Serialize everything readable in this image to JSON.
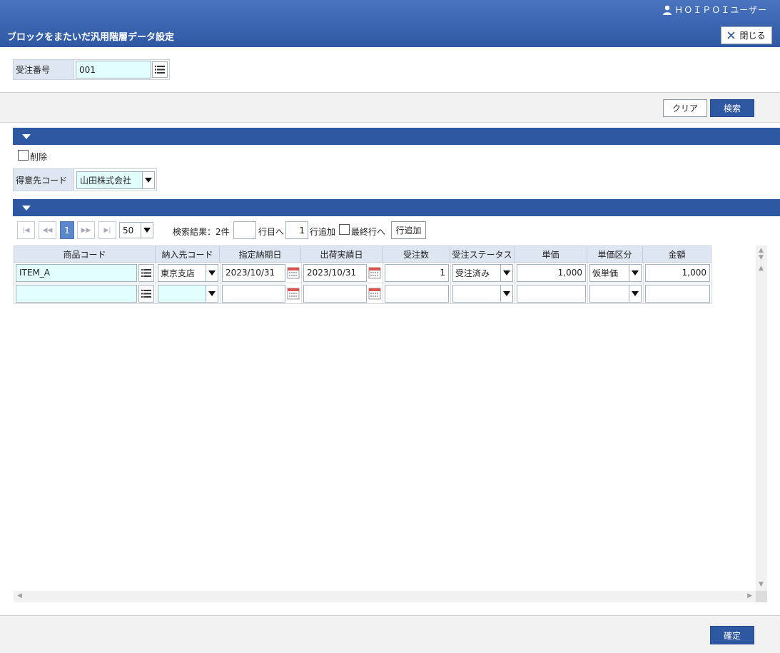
{
  "header": {
    "user_name": "ＨＯＩＰＯＩユーザー",
    "title": "ブロックをまたいだ汎用階層データ設定",
    "close_label": "閉じる"
  },
  "search": {
    "order_no_label": "受注番号",
    "order_no_value": "001",
    "clear_label": "クリア",
    "search_label": "検索"
  },
  "block1": {
    "delete_label": "削除",
    "customer_label": "得意先コード",
    "customer_value": "山田株式会社"
  },
  "pager": {
    "current_page": "1",
    "page_size": "50",
    "result_text": "検索結果：2件",
    "row_goto_value": "",
    "row_goto_label": "行目へ",
    "add_count": "1",
    "add_count_label": "行追加",
    "last_row_label": "最終行へ",
    "add_row_button": "行追加"
  },
  "grid": {
    "columns": [
      "商品コード",
      "納入先コード",
      "指定納期日",
      "出荷実績日",
      "受注数",
      "受注ステータス",
      "単価",
      "単価区分",
      "金額"
    ],
    "rows": [
      {
        "item_code": "ITEM_A",
        "delivery_code": "東京支店",
        "due_date": "2023/10/31",
        "ship_date": "2023/10/31",
        "qty": "1",
        "status": "受注済み",
        "unit_price": "1,000",
        "price_type": "仮単価",
        "amount": "1,000"
      },
      {
        "item_code": "",
        "delivery_code": "",
        "due_date": "",
        "ship_date": "",
        "qty": "",
        "status": "",
        "unit_price": "",
        "price_type": "",
        "amount": ""
      }
    ]
  },
  "footer": {
    "confirm_label": "確定"
  },
  "colors": {
    "header_blue": "#2f58a3",
    "label_bg": "#dde6f1",
    "input_cyan": "#e2fdfe",
    "pager_active": "#5b86c9"
  }
}
